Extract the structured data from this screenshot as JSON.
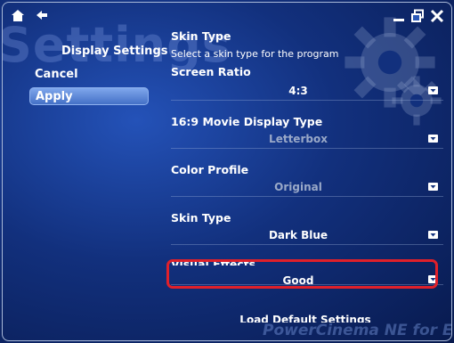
{
  "watermark": "Settings",
  "left_panel": {
    "title": "Display Settings",
    "cancel": "Cancel",
    "apply": "Apply"
  },
  "settings": {
    "skin_type_header": "Skin Type",
    "skin_type_desc": "Select a skin type for the program",
    "screen_ratio": {
      "label": "Screen Ratio",
      "value": "4:3"
    },
    "movie_display": {
      "label": "16:9 Movie Display Type",
      "value": "Letterbox"
    },
    "color_profile": {
      "label": "Color Profile",
      "value": "Original"
    },
    "skin_type": {
      "label": "Skin Type",
      "value": "Dark Blue"
    },
    "visual_effects": {
      "label": "Visual Effects",
      "value": "Good"
    }
  },
  "load_default": "Load Default Settings",
  "footer_brand": "PowerCinema NE for Everio",
  "icons": [
    "home-icon",
    "back-icon",
    "minimize-icon",
    "restore-icon",
    "close-icon",
    "gear-icon",
    "dropdown-arrow-icon"
  ],
  "colors": {
    "highlight": "#e0202a",
    "apply_bg": "#5b86d8"
  }
}
